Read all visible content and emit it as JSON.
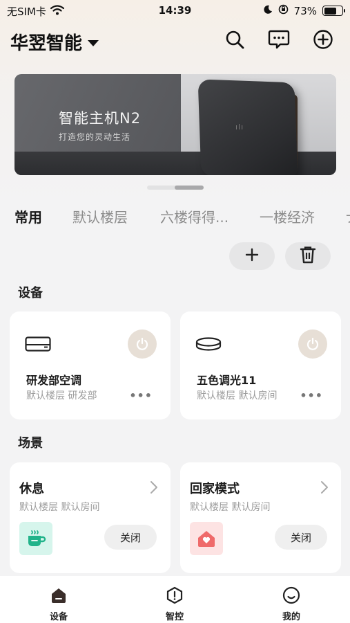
{
  "status_bar": {
    "carrier": "无SIM卡",
    "time": "14:39",
    "battery": "73%",
    "battery_level": 0.73,
    "icons": [
      "wifi-icon",
      "moon-icon",
      "rotation-lock-icon",
      "battery-icon"
    ]
  },
  "header": {
    "home_name": "华翌智能",
    "icons": [
      "search-icon",
      "message-icon",
      "add-circle-icon"
    ]
  },
  "banner": {
    "title": "智能主机N2",
    "subtitle": "打造您的灵动生活",
    "device_logo": "ılı"
  },
  "floor_tabs": [
    {
      "label": "常用",
      "active": true
    },
    {
      "label": "默认楼层",
      "active": false
    },
    {
      "label": "六楼得得...",
      "active": false
    },
    {
      "label": "一楼经济",
      "active": false
    },
    {
      "label": "ナ",
      "active": false
    }
  ],
  "actions": {
    "add_icon": "plus-icon",
    "delete_icon": "trash-icon"
  },
  "devices_section": {
    "title": "设备",
    "items": [
      {
        "name": "研发部空调",
        "meta": "默认楼层 研发部",
        "icon": "air-conditioner-icon",
        "more": "•••"
      },
      {
        "name": "五色调光11",
        "meta": "默认楼层 默认房间",
        "icon": "ceiling-light-icon",
        "more": "•••"
      }
    ]
  },
  "scenes_section": {
    "title": "场景",
    "items": [
      {
        "name": "休息",
        "meta": "默认楼层 默认房间",
        "icon": "coffee-cup-icon",
        "icon_bg": "#d6f5ec",
        "icon_color": "#21b38a",
        "button": "关闭"
      },
      {
        "name": "回家模式",
        "meta": "默认楼层 默认房间",
        "icon": "home-heart-icon",
        "icon_bg": "#fde3e3",
        "icon_color": "#ef6a6a",
        "button": "关闭"
      }
    ]
  },
  "bottom_nav": [
    {
      "label": "设备",
      "icon": "home-icon",
      "active": true
    },
    {
      "label": "智控",
      "icon": "smart-control-icon",
      "active": false
    },
    {
      "label": "我的",
      "icon": "smile-icon",
      "active": false
    }
  ],
  "colors": {
    "accent_dark": "#3a2e2a",
    "power_bg": "#e7dfd6",
    "page_bg": "#f3f3f4"
  }
}
